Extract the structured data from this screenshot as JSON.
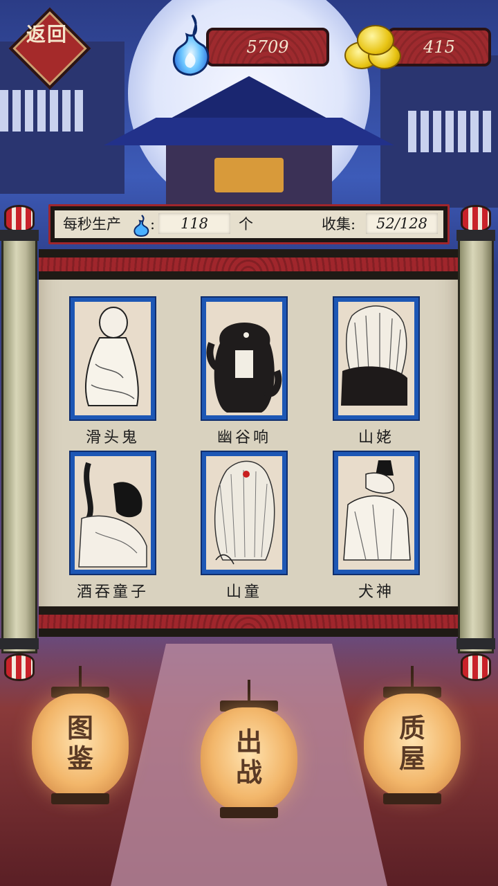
{
  "header": {
    "back_label": "返回",
    "soul_count": "5709",
    "coin_count": "415"
  },
  "info_bar": {
    "per_second_label": "每秒生产",
    "colon": ":",
    "per_second_value": "118",
    "per_second_unit": "个",
    "collect_label": "收集:",
    "collect_value": "52/128"
  },
  "cards": [
    {
      "name": "滑头鬼"
    },
    {
      "name": "幽谷响"
    },
    {
      "name": "山姥"
    },
    {
      "name": "酒吞童子"
    },
    {
      "name": "山童"
    },
    {
      "name": "犬神"
    }
  ],
  "lanterns": [
    {
      "label": "图\n鉴"
    },
    {
      "label": "出\n战"
    },
    {
      "label": "质\n屋"
    }
  ],
  "colors": {
    "accent_red": "#a0262c",
    "card_blue": "#1d57b5",
    "scroll_paper": "#d9d2bf",
    "flame_blue": "#3aa6ff",
    "coin_gold": "#e8c414"
  }
}
